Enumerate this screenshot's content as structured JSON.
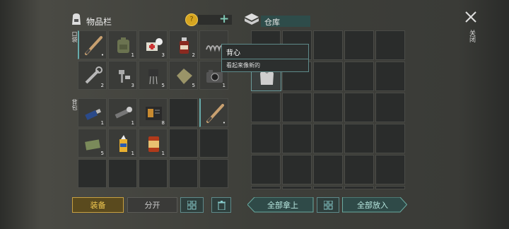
{
  "backpack": {
    "title": "物品栏",
    "coins": "0",
    "plus": "+",
    "section_pockets": "口袋",
    "section_bag": "背包"
  },
  "pocket_items": [
    {
      "name": "baseball-bat",
      "count": ""
    },
    {
      "name": "military-backpack",
      "count": "1"
    },
    {
      "name": "first-aid-bandage",
      "count": "3"
    },
    {
      "name": "medicine-bottle",
      "count": "2"
    },
    {
      "name": "spring-coil",
      "count": ""
    },
    {
      "name": "wrench",
      "count": "2"
    },
    {
      "name": "bolts",
      "count": "3"
    },
    {
      "name": "electronic-parts",
      "count": "5"
    },
    {
      "name": "cloth-scrap",
      "count": "5"
    },
    {
      "name": "camera",
      "count": "1"
    }
  ],
  "bag_items": [
    {
      "name": "usb-drive",
      "count": "1"
    },
    {
      "name": "flashlight",
      "count": "1"
    },
    {
      "name": "book",
      "count": "8"
    },
    {
      "name": "empty",
      "count": ""
    },
    {
      "name": "baseball-bat",
      "count": ""
    },
    {
      "name": "cloth-bundle",
      "count": "5"
    },
    {
      "name": "glue-tube",
      "count": "1"
    },
    {
      "name": "canned-food",
      "count": "1"
    }
  ],
  "storage": {
    "title": "仓库"
  },
  "tooltip": {
    "title": "背心",
    "desc": "看起来像新的"
  },
  "buttons": {
    "equip": "装备",
    "split": "分开",
    "take_all": "全部拿上",
    "put_all": "全部放入"
  },
  "close_label": "关闭"
}
